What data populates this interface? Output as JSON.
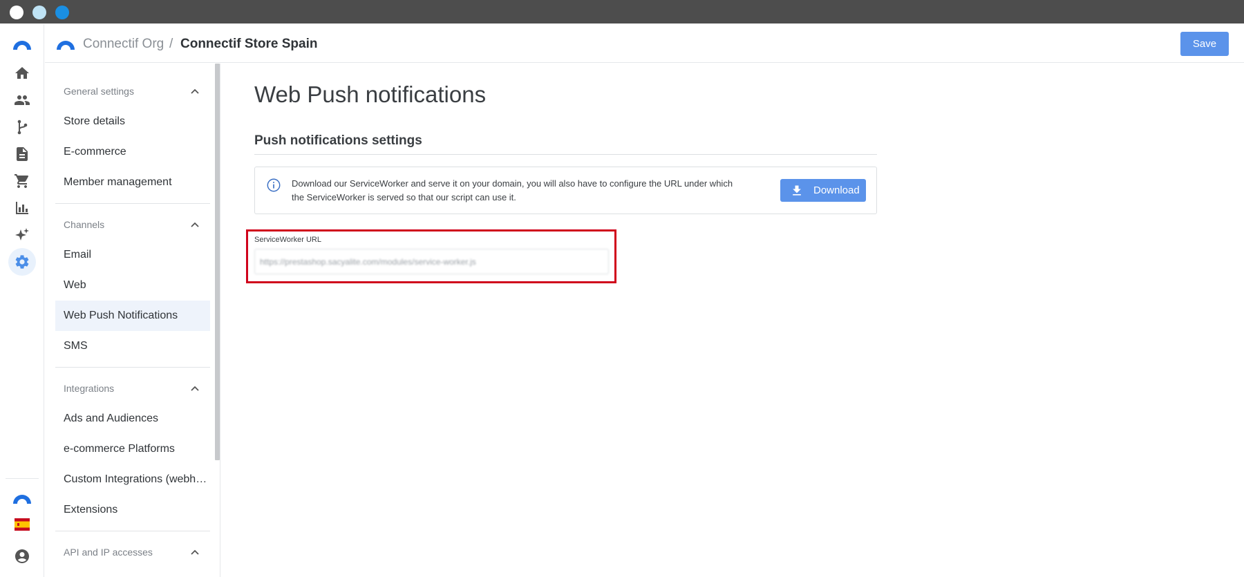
{
  "window": {
    "controls": [
      "close",
      "minimize",
      "maximize"
    ]
  },
  "rail": {
    "items": [
      {
        "icon": "home-icon"
      },
      {
        "icon": "people-icon"
      },
      {
        "icon": "workflow-icon"
      },
      {
        "icon": "document-icon"
      },
      {
        "icon": "cart-icon"
      },
      {
        "icon": "bar-chart-icon"
      },
      {
        "icon": "sparkles-icon"
      },
      {
        "icon": "gear-icon",
        "active": true
      }
    ],
    "bottom": [
      {
        "icon": "connectif-logo-icon"
      },
      {
        "icon": "spain-flag-icon"
      },
      {
        "icon": "account-icon"
      }
    ]
  },
  "header": {
    "org": "Connectif Org",
    "separator": "/",
    "store": "Connectif Store Spain",
    "save_label": "Save"
  },
  "nav": {
    "sections": [
      {
        "title": "General settings",
        "items": [
          "Store details",
          "E-commerce",
          "Member management"
        ]
      },
      {
        "title": "Channels",
        "items": [
          "Email",
          "Web",
          "Web Push Notifications",
          "SMS"
        ]
      },
      {
        "title": "Integrations",
        "items": [
          "Ads and Audiences",
          "e-commerce Platforms",
          "Custom Integrations (webh…",
          "Extensions"
        ]
      },
      {
        "title": "API and IP accesses",
        "items": []
      }
    ],
    "active_item": "Web Push Notifications"
  },
  "main": {
    "title": "Web Push notifications",
    "subtitle": "Push notifications settings",
    "info_text": "Download our ServiceWorker and serve it on your domain, you will also have to configure the URL under which the ServiceWorker is served so that our script can use it.",
    "download_label": "Download",
    "field_label": "ServiceWorker URL",
    "field_value": "https://prestashop.sacyalite.com/modules/service-worker.js"
  },
  "colors": {
    "accent": "#5b93ea",
    "highlight": "#d0021b",
    "titlebar": "#4d4d4d"
  }
}
